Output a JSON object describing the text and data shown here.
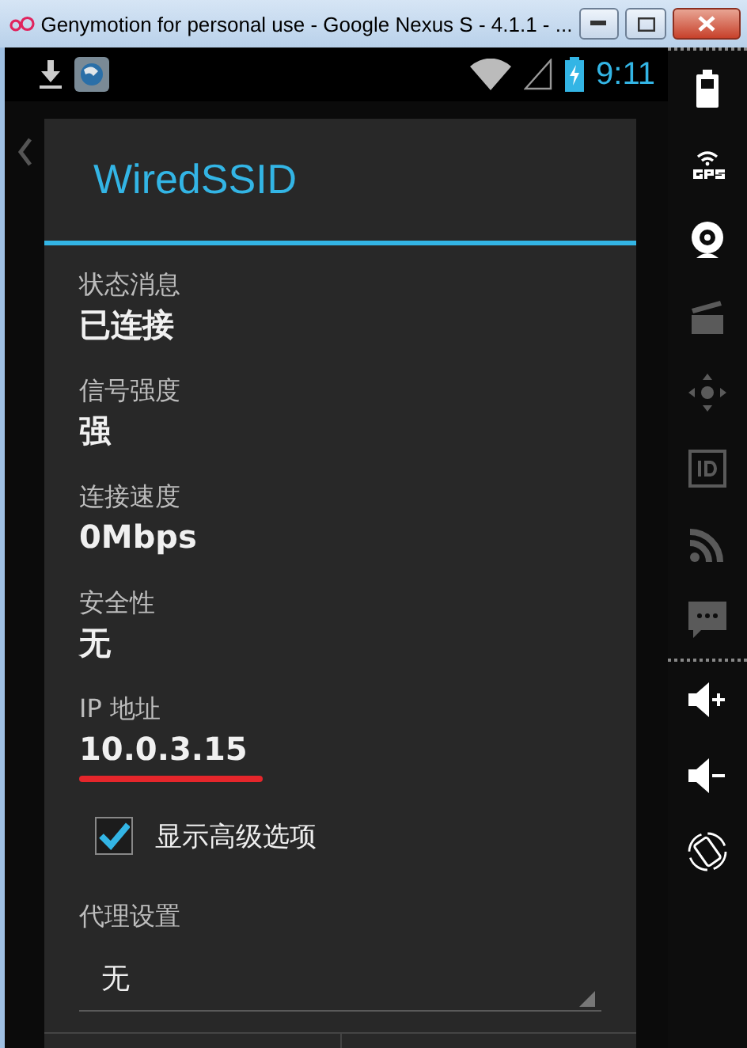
{
  "window": {
    "title": "Genymotion for personal use - Google Nexus S - 4.1.1 - ..."
  },
  "status_bar": {
    "time": "9:11"
  },
  "dialog": {
    "title": "WiredSSID",
    "fields": [
      {
        "label": "状态消息",
        "value": "已连接"
      },
      {
        "label": "信号强度",
        "value": "强"
      },
      {
        "label": "连接速度",
        "value": "0Mbps"
      },
      {
        "label": "安全性",
        "value": "无"
      },
      {
        "label": "IP 地址",
        "value": "10.0.3.15",
        "underlined": true
      }
    ],
    "advanced": {
      "label": "显示高级选项",
      "checked": true
    },
    "proxy": {
      "label": "代理设置",
      "value": "无"
    }
  },
  "sidebar": {
    "tools": [
      {
        "kind": "battery",
        "enabled": true
      },
      {
        "kind": "gps",
        "enabled": true
      },
      {
        "kind": "webcam",
        "enabled": true
      },
      {
        "kind": "clapper",
        "enabled": false
      },
      {
        "kind": "dpad",
        "enabled": false
      },
      {
        "kind": "id",
        "enabled": false
      },
      {
        "kind": "rss",
        "enabled": false
      },
      {
        "kind": "message",
        "enabled": false
      }
    ],
    "controls": [
      {
        "kind": "volume-up"
      },
      {
        "kind": "volume-down"
      },
      {
        "kind": "rotate"
      }
    ]
  }
}
